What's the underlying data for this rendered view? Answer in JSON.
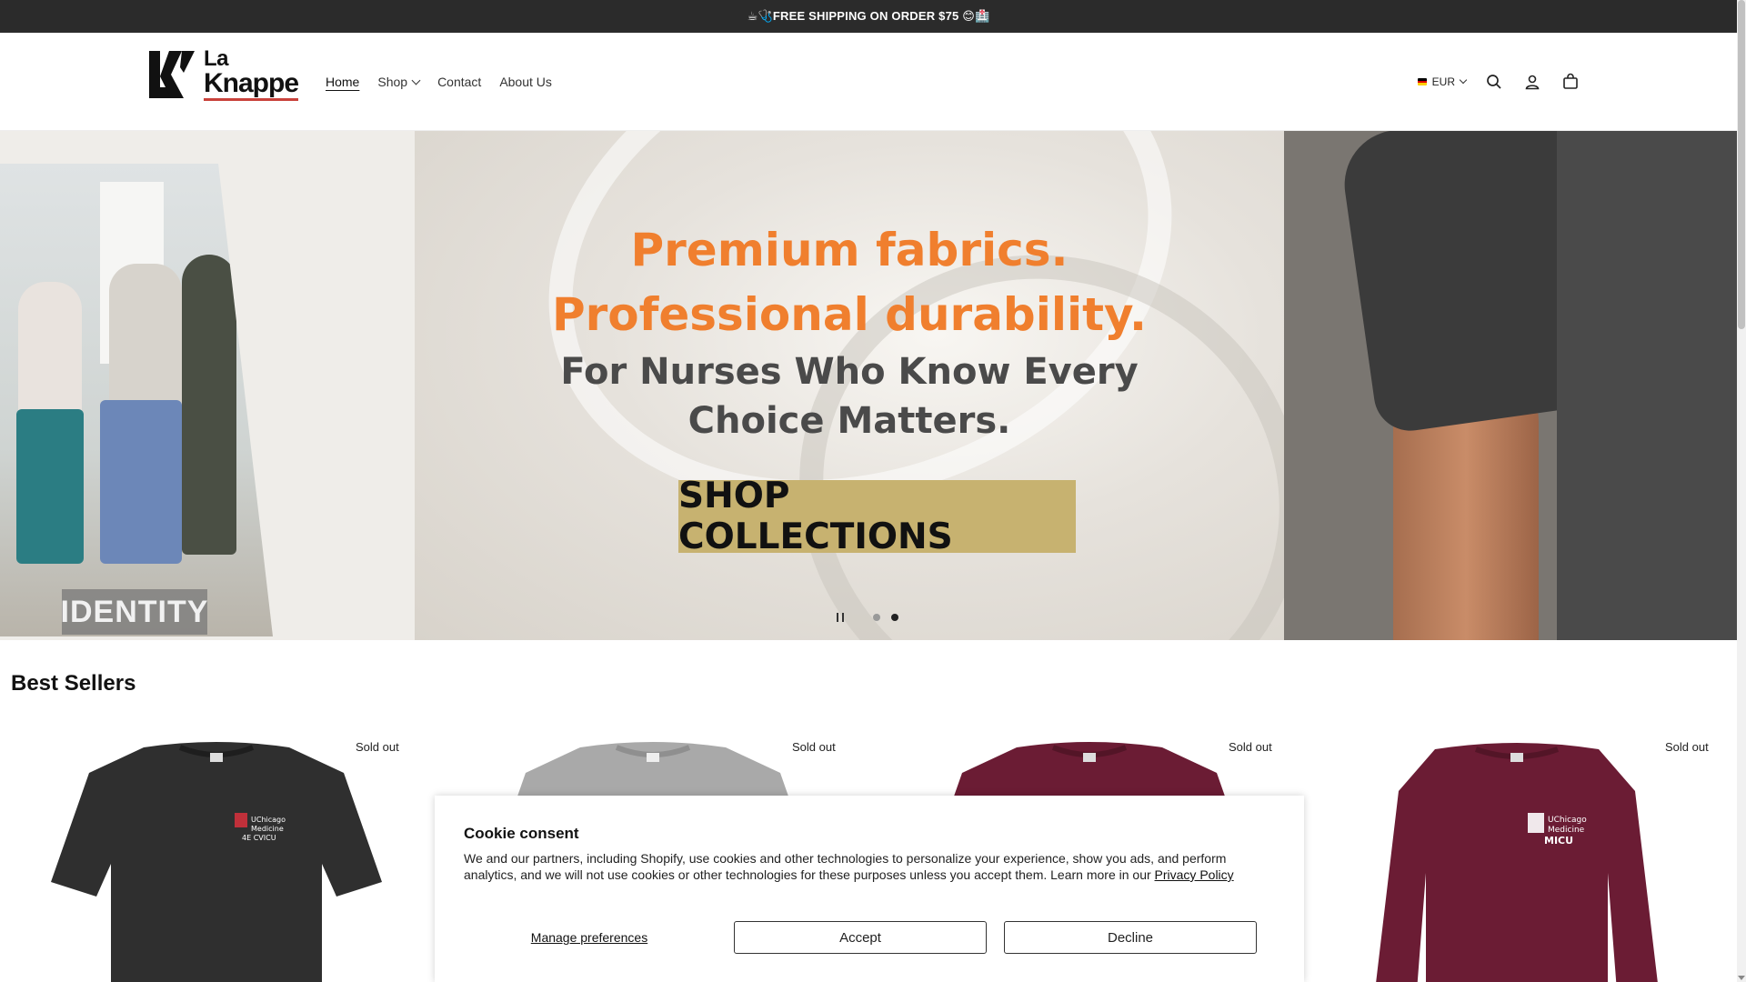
{
  "announcement": {
    "text": "☕🩺FREE SHIPPING ON ORDER $75 😊🏥"
  },
  "header": {
    "logo": {
      "line1": "La",
      "line2": "Knappe",
      "mark_icon": "lk-monogram-icon"
    },
    "nav": [
      {
        "label": "Home",
        "active": true
      },
      {
        "label": "Shop",
        "has_dropdown": true
      },
      {
        "label": "Contact"
      },
      {
        "label": "About Us"
      }
    ],
    "currency": {
      "label": "EUR",
      "flag_icon": "germany-flag-icon"
    },
    "icons": [
      "search-icon",
      "account-icon",
      "cart-icon"
    ]
  },
  "hero": {
    "headline_line1": "Premium fabrics.",
    "headline_line2": "Professional durability.",
    "sub_line1": "For Nurses Who Know Every",
    "sub_line2": "Choice Matters.",
    "cta": "SHOP COLLECTIONS",
    "side_label": "IDENTITY",
    "slides": 2,
    "active_slide": 2,
    "colors": {
      "headline": "#f07f2e",
      "cta_bg": "#c7b270"
    }
  },
  "best_sellers": {
    "title": "Best Sellers",
    "products": [
      {
        "badge": "Sold out",
        "shirt_color": "#2f2f2f",
        "print": [
          "UChicago",
          "Medicine",
          "4E CVICU"
        ],
        "sleeve": "short"
      },
      {
        "badge": "Sold out",
        "shirt_color": "#a9a9a9",
        "print": [],
        "sleeve": "short"
      },
      {
        "badge": "Sold out",
        "shirt_color": "#6b1c34",
        "print": [],
        "sleeve": "short"
      },
      {
        "badge": "Sold out",
        "shirt_color": "#6b1c34",
        "print": [
          "UChicago",
          "Medicine",
          "MICU"
        ],
        "sleeve": "long"
      }
    ]
  },
  "cookie": {
    "title": "Cookie consent",
    "body": "We and our partners, including Shopify, use cookies and other technologies to personalize your experience, show you ads, and perform analytics, and we will not use cookies or other technologies for these purposes unless you accept them. Learn more in our",
    "policy_link": "Privacy Policy",
    "manage": "Manage preferences",
    "accept": "Accept",
    "decline": "Decline"
  }
}
